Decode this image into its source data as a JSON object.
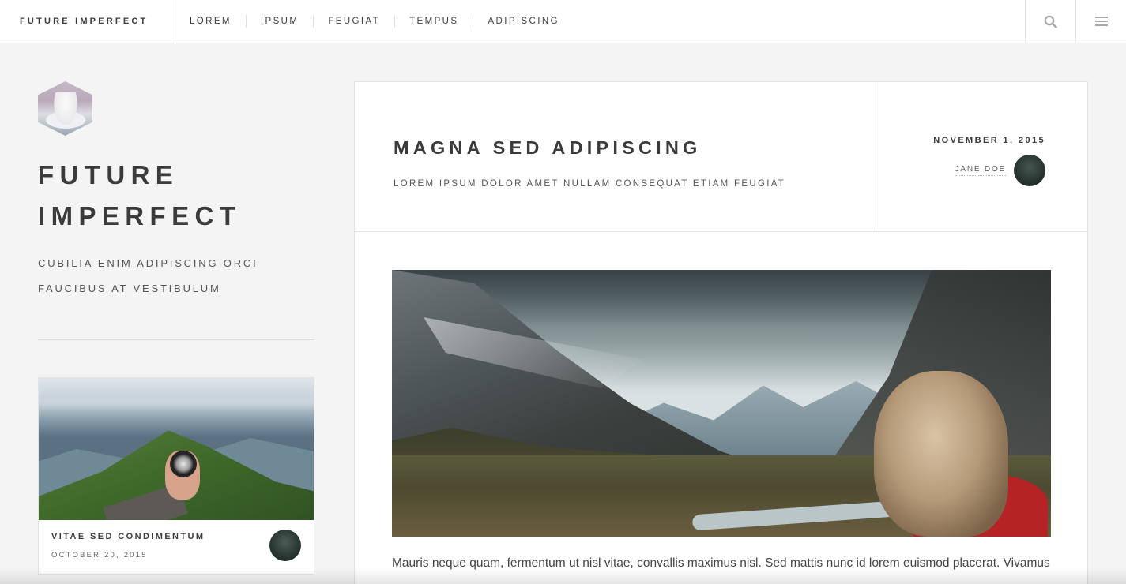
{
  "brand": "FUTURE IMPERFECT",
  "nav": [
    "LOREM",
    "IPSUM",
    "FEUGIAT",
    "TEMPUS",
    "ADIPISCING"
  ],
  "icons": {
    "search": "search-icon",
    "menu": "hamburger-menu-icon"
  },
  "sidebar": {
    "title": "FUTURE IMPERFECT",
    "subtitle": "CUBILIA ENIM ADIPISCING ORCI FAUCIBUS AT VESTIBULUM",
    "card": {
      "title": "VITAE SED CONDIMENTUM",
      "date": "OCTOBER 20, 2015"
    }
  },
  "post": {
    "title": "MAGNA SED ADIPISCING",
    "subtitle": "LOREM IPSUM DOLOR AMET NULLAM CONSEQUAT ETIAM FEUGIAT",
    "date": "NOVEMBER 1, 2015",
    "author": "JANE DOE",
    "body": "Mauris neque quam, fermentum ut nisl vitae, convallis maximus nisl. Sed mattis nunc id lorem euismod placerat. Vivamus"
  },
  "colors": {
    "text": "#3c3b3b",
    "background": "#f4f4f4",
    "panel": "#ffffff",
    "border": "#e3e3e3"
  }
}
